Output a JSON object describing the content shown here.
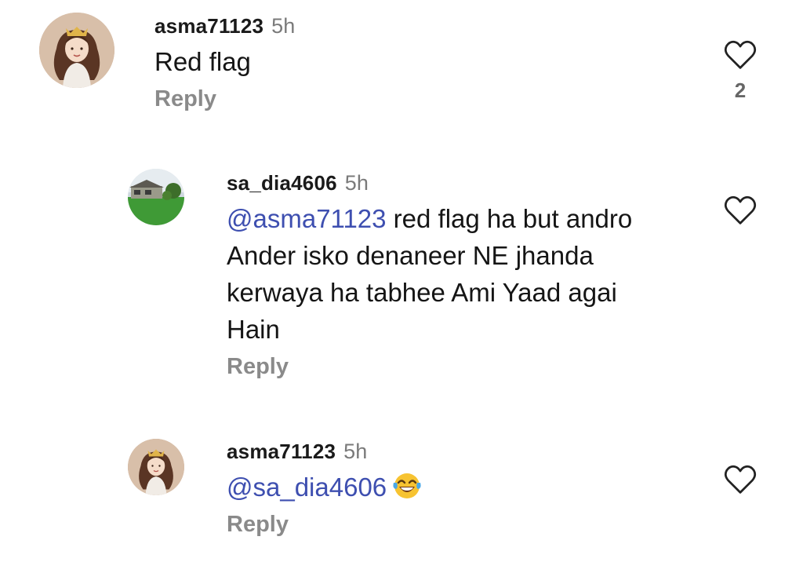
{
  "comments": [
    {
      "username": "asma71123",
      "time": "5h",
      "text": "Red flag",
      "reply_label": "Reply",
      "like_count": "2",
      "avatar_icon": "girl-crown-avatar-icon",
      "like_icon": "heart-outline-icon"
    },
    {
      "username": "sa_dia4606",
      "time": "5h",
      "mention": "@asma71123",
      "text": " red flag ha but andro Ander isko denaneer NE jhanda kerwaya ha tabhee Ami Yaad agai Hain",
      "reply_label": "Reply",
      "avatar_icon": "house-garden-avatar-icon",
      "like_icon": "heart-outline-icon"
    },
    {
      "username": "asma71123",
      "time": "5h",
      "mention": "@sa_dia4606",
      "emoji_icon": "face-with-tears-of-joy-icon",
      "reply_label": "Reply",
      "avatar_icon": "girl-crown-avatar-icon",
      "like_icon": "heart-outline-icon"
    }
  ],
  "colors": {
    "mention": "#3e4fb0",
    "secondary_text": "#7a7a7a",
    "reply_text": "#8a8a8a"
  }
}
